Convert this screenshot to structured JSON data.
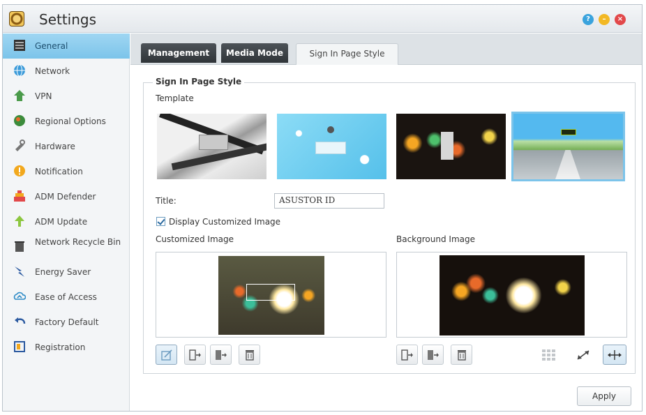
{
  "window": {
    "title": "Settings"
  },
  "sidebar": {
    "items": [
      {
        "label": "General",
        "icon": "general-icon",
        "active": true
      },
      {
        "label": "Network",
        "icon": "globe-icon"
      },
      {
        "label": "VPN",
        "icon": "vpn-icon"
      },
      {
        "label": "Regional Options",
        "icon": "regional-icon"
      },
      {
        "label": "Hardware",
        "icon": "hardware-icon"
      },
      {
        "label": "Notification",
        "icon": "notification-icon"
      },
      {
        "label": "ADM Defender",
        "icon": "defender-icon"
      },
      {
        "label": "ADM Update",
        "icon": "update-icon"
      },
      {
        "label": "Network Recycle Bin",
        "icon": "recycle-bin-icon"
      },
      {
        "label": "Energy Saver",
        "icon": "energy-icon"
      },
      {
        "label": "Ease of Access",
        "icon": "ease-of-access-icon"
      },
      {
        "label": "Factory Default",
        "icon": "factory-default-icon"
      },
      {
        "label": "Registration",
        "icon": "registration-icon"
      }
    ]
  },
  "tabs": [
    {
      "label": "Management"
    },
    {
      "label": "Media Mode"
    },
    {
      "label": "Sign In Page Style",
      "active": true
    }
  ],
  "content": {
    "group_title": "Sign In Page Style",
    "template_label": "Template",
    "selected_template": 4,
    "title_label": "Title:",
    "title_value": "ASUSTOR ID",
    "display_custom_label": "Display Customized Image",
    "display_custom_checked": true,
    "custom_image_label": "Customized Image",
    "background_image_label": "Background Image",
    "apply_label": "Apply"
  },
  "colors": {
    "accent": "#7cc4ea",
    "tab_dark": "#3a3f44",
    "help": "#3aa3dd",
    "minimize": "#f2b824",
    "close": "#e2484a"
  }
}
